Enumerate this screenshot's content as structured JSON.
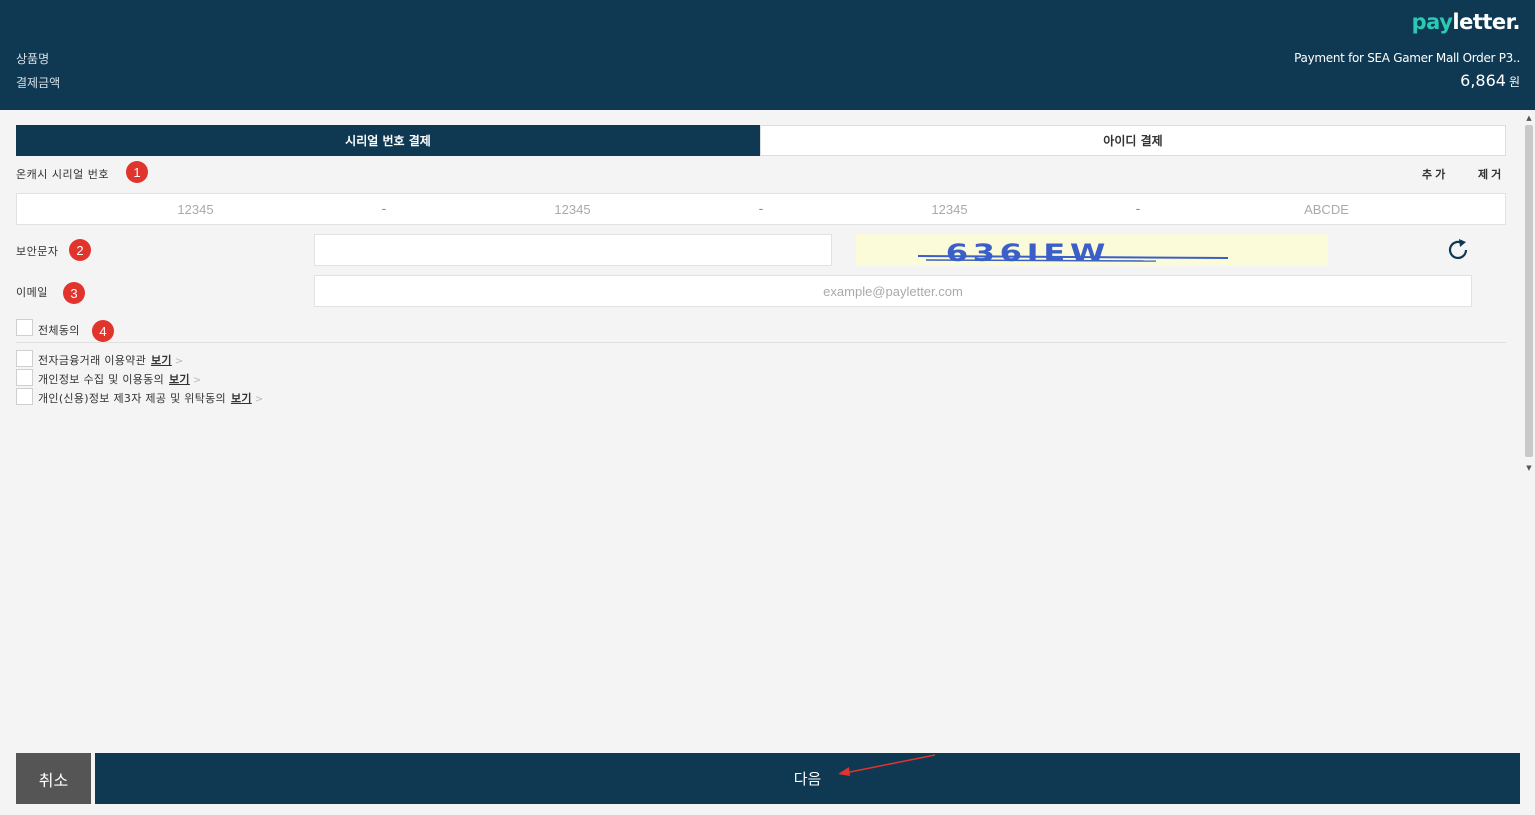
{
  "brand": {
    "logo_part1": "pay",
    "logo_part2": "letter."
  },
  "header": {
    "product_label": "상품명",
    "amount_label": "결제금액",
    "product_name": "Payment for SEA Gamer Mall Order P3..",
    "amount": "6,864",
    "currency": "원"
  },
  "tabs": [
    {
      "label": "시리얼 번호 결제",
      "active": true
    },
    {
      "label": "아이디 결제",
      "active": false
    }
  ],
  "serial": {
    "label": "온캐시 시리얼 번호",
    "badge": "1",
    "add_label": "추가",
    "remove_label": "제거",
    "placeholders": [
      "12345",
      "12345",
      "12345",
      "ABCDE"
    ],
    "separator": "-"
  },
  "security": {
    "label": "보안문자",
    "badge": "2",
    "captcha_text": "636IEW",
    "refresh_icon": "refresh-icon"
  },
  "email": {
    "label": "이메일",
    "badge": "3",
    "placeholder": "example@payletter.com"
  },
  "agreements": {
    "all_label": "전체동의",
    "all_badge": "4",
    "items": [
      {
        "label": "전자금융거래 이용약관",
        "link": "보기"
      },
      {
        "label": "개인정보 수집 및 이용동의",
        "link": "보기"
      },
      {
        "label": "개인(신용)정보 제3자 제공 및 위탁동의",
        "link": "보기"
      }
    ],
    "chevron": ">"
  },
  "buttons": {
    "cancel": "취소",
    "next": "다음"
  },
  "colors": {
    "navy": "#0f3852",
    "accent": "#2bc9b4",
    "badge_red": "#e0342d",
    "captcha_text": "#3b5fc8"
  }
}
